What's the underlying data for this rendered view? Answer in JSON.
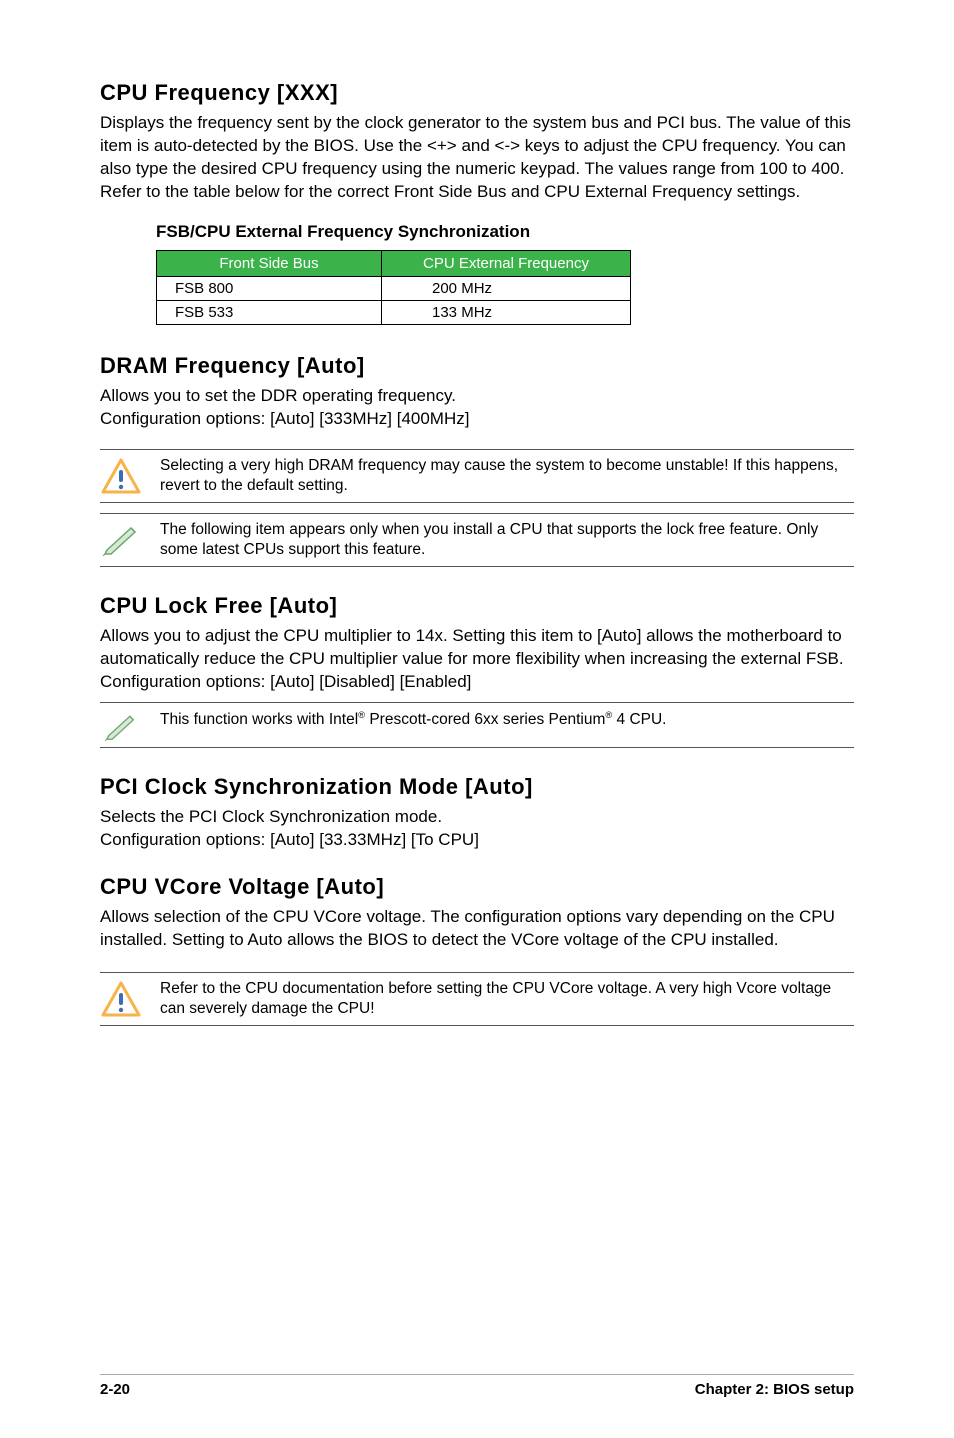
{
  "sections": {
    "cpu_freq": {
      "heading": "CPU Frequency [XXX]",
      "body": "Displays the frequency sent by the clock generator to the system bus and PCI bus. The value of this item is auto-detected by the BIOS. Use the <+> and <-> keys to adjust the CPU frequency. You can also type the desired CPU frequency using the numeric keypad. The values range from 100 to 400. Refer to the table below for the correct Front Side Bus and CPU External Frequency settings.",
      "table_title": "FSB/CPU External Frequency Synchronization",
      "table_headers": [
        "Front Side Bus",
        "CPU External Frequency"
      ],
      "table_rows": [
        [
          "FSB 800",
          "200 MHz"
        ],
        [
          "FSB 533",
          "133 MHz"
        ]
      ]
    },
    "dram_freq": {
      "heading": "DRAM Frequency [Auto]",
      "body": "Allows you to set the DDR operating frequency.\nConfiguration options: [Auto] [333MHz] [400MHz]",
      "warning_note": "Selecting a very high DRAM frequency may cause the system to become unstable! If this happens, revert to the default setting.",
      "info_note": "The following item appears only when you install a CPU that supports the lock free feature. Only some latest CPUs support this feature."
    },
    "cpu_lock_free": {
      "heading": "CPU Lock Free [Auto]",
      "body": "Allows you to adjust the CPU multiplier to 14x. Setting this item to [Auto] allows the motherboard to automatically reduce the CPU multiplier value for more flexibility when increasing the external FSB.\nConfiguration options: [Auto] [Disabled] [Enabled]",
      "note_pre": "This function works with ",
      "note_bold1": "Intel",
      "note_mid": " Prescott-cored 6xx series Pentium",
      "note_post": " 4 CPU."
    },
    "pci_clock": {
      "heading": "PCI Clock Synchronization Mode [Auto]",
      "body": "Selects the PCI Clock Synchronization mode.\nConfiguration options: [Auto] [33.33MHz] [To CPU]"
    },
    "cpu_vcore": {
      "heading": "CPU VCore Voltage [Auto]",
      "body": "Allows selection of the CPU VCore voltage. The configuration options vary depending on the CPU installed. Setting to Auto allows the BIOS to detect the VCore voltage of the CPU installed.",
      "warning_note": "Refer to the CPU documentation before setting the CPU VCore voltage. A very high Vcore voltage can severely damage the CPU!"
    }
  },
  "footer": {
    "page": "2-20",
    "chapter_label": "Chapter 2",
    "chapter_title": " BIOS setup"
  }
}
